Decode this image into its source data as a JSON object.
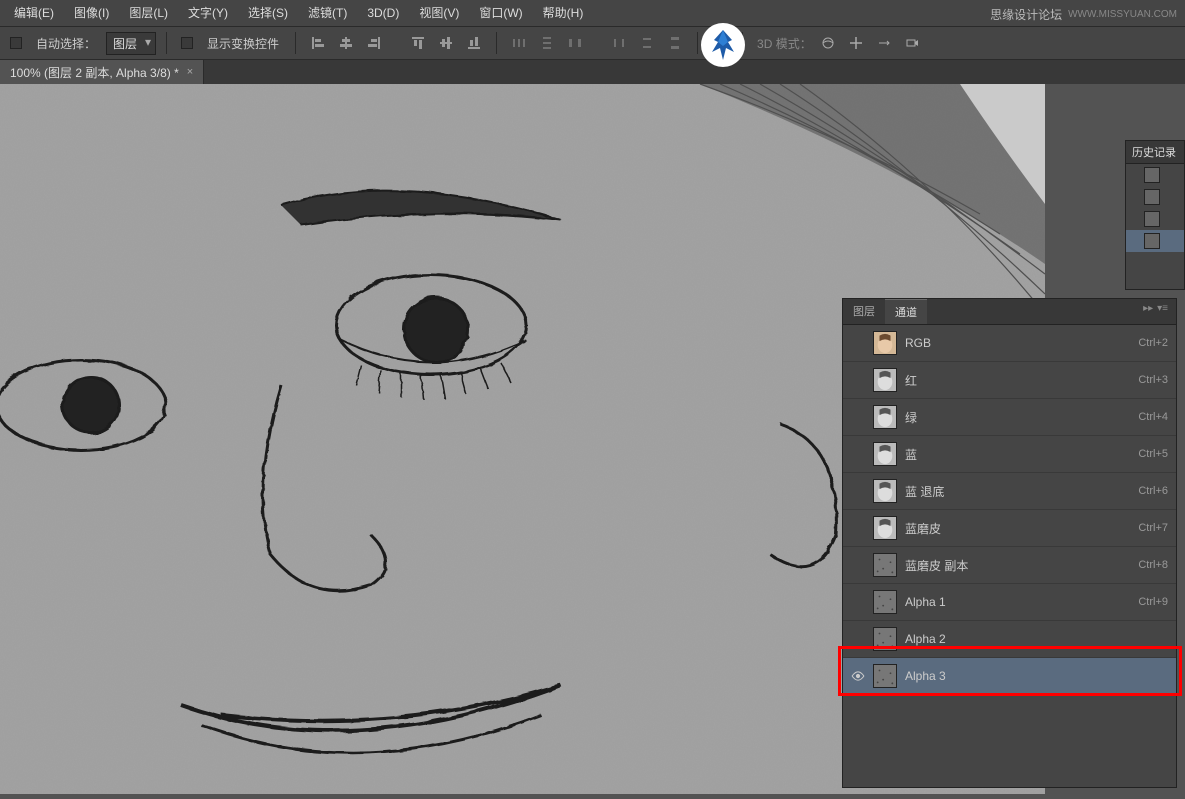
{
  "menubar": {
    "items": [
      {
        "label": "编辑(E)"
      },
      {
        "label": "图像(I)"
      },
      {
        "label": "图层(L)"
      },
      {
        "label": "文字(Y)"
      },
      {
        "label": "选择(S)"
      },
      {
        "label": "滤镜(T)"
      },
      {
        "label": "3D(D)"
      },
      {
        "label": "视图(V)"
      },
      {
        "label": "窗口(W)"
      },
      {
        "label": "帮助(H)"
      }
    ]
  },
  "optionsbar": {
    "auto_select_label": "自动选择：",
    "dropdown_value": "图层",
    "show_transform_label": "显示变换控件",
    "mode3d_label": "3D 模式："
  },
  "watermark": {
    "text": "思缘设计论坛",
    "url": "WWW.MISSYUAN.COM"
  },
  "tab": {
    "title": "100% (图层 2 副本, Alpha 3/8) *",
    "close": "×"
  },
  "history": {
    "title": "历史记录"
  },
  "channels_panel": {
    "tabs": [
      {
        "label": "图层"
      },
      {
        "label": "通道"
      }
    ],
    "channels": [
      {
        "name": "RGB",
        "shortcut": "Ctrl+2",
        "thumb": "color"
      },
      {
        "name": "红",
        "shortcut": "Ctrl+3",
        "thumb": "gray"
      },
      {
        "name": "绿",
        "shortcut": "Ctrl+4",
        "thumb": "gray"
      },
      {
        "name": "蓝",
        "shortcut": "Ctrl+5",
        "thumb": "gray"
      },
      {
        "name": "蓝 退底",
        "shortcut": "Ctrl+6",
        "thumb": "gray"
      },
      {
        "name": "蓝磨皮",
        "shortcut": "Ctrl+7",
        "thumb": "gray"
      },
      {
        "name": "蓝磨皮 副本",
        "shortcut": "Ctrl+8",
        "thumb": "noise"
      },
      {
        "name": "Alpha 1",
        "shortcut": "Ctrl+9",
        "thumb": "noise"
      },
      {
        "name": "Alpha 2",
        "shortcut": "",
        "thumb": "noise"
      },
      {
        "name": "Alpha 3",
        "shortcut": "",
        "thumb": "noise",
        "selected": true,
        "visible": true
      }
    ]
  }
}
